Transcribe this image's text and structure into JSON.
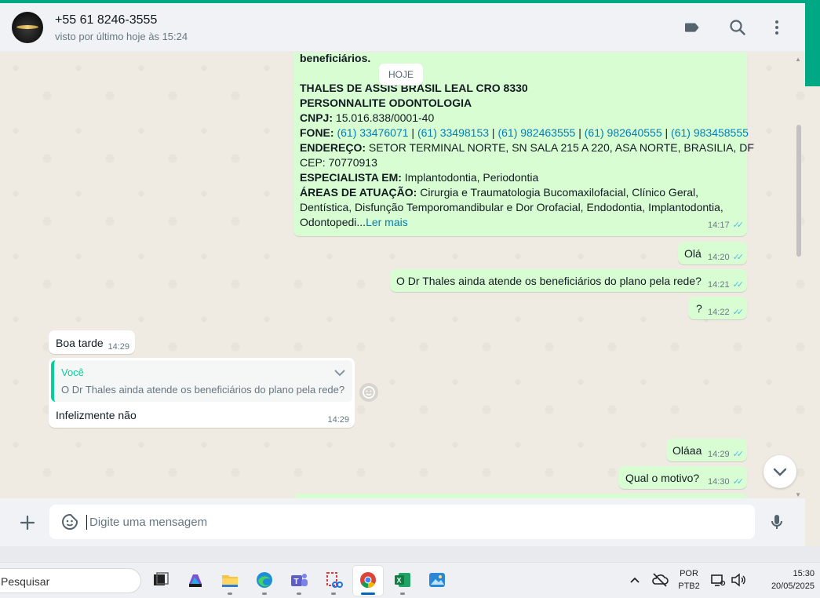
{
  "header": {
    "contact_name": "+55 61 8246-3555",
    "status": "visto por último hoje às 15:24",
    "icons": [
      "label-icon",
      "search-icon",
      "more-vertical-icon"
    ]
  },
  "date_chip": "HOJE",
  "big_message": {
    "line0_bold": "beneficiários.",
    "line1_bold": "THALES DE ASSIS BRASIL LEAL CRO 8330",
    "line2_bold": "PERSONNALITE ODONTOLOGIA",
    "cnpj_label": "CNPJ:",
    "cnpj_value": " 15.016.838/0001-40",
    "fone_label": "FONE:",
    "phones": [
      "(61) 33476071",
      "(61) 33498153",
      "(61) 982463555",
      "(61) 982640555",
      "(61) 983458555"
    ],
    "phone_sep": " | ",
    "endereco_label": "ENDEREÇO:",
    "endereco_value": " SETOR TERMINAL NORTE, SN SALA 215 A 220, ASA NORTE, BRASILIA, DF",
    "cep": "CEP: 70770913",
    "especialista_label": "ESPECIALISTA EM:",
    "especialista_value": " Implantodontia, Periodontia",
    "areas_label": "ÁREAS DE ATUAÇÃO:",
    "areas_value_1": " Cirurgia e Traumatologia Bucomaxilofacial, Clínico Geral,",
    "areas_value_2": "Dentística, Disfunção Temporomandibular e Dor Orofacial, Endodontia, Implantodontia,",
    "areas_value_3": "Odontopedi...",
    "read_more": "Ler mais",
    "time": "14:17"
  },
  "messages": [
    {
      "text": "Olá",
      "time": "14:20"
    },
    {
      "text": "O Dr Thales ainda atende os beneficiários do plano pela rede?",
      "time": "14:21"
    },
    {
      "text": "?",
      "time": "14:22"
    },
    {
      "text": "Boa tarde",
      "time": "14:29"
    },
    {
      "quote_author": "Você",
      "quote_text": "O Dr Thales ainda atende os beneficiários do plano pela rede?",
      "text": "Infelizmente não",
      "time": "14:29"
    },
    {
      "text": "Oláaa",
      "time": "14:29"
    },
    {
      "text": "Qual o motivo?",
      "time": "14:30"
    }
  ],
  "composer": {
    "placeholder": "Digite uma mensagem"
  },
  "taskbar": {
    "search_label": "Pesquisar",
    "lang_top": "POR",
    "lang_bottom": "PTB2",
    "clock_time": "15:30",
    "clock_date": "20/05/2025"
  },
  "colors": {
    "accent": "#00a884",
    "outgoing": "#d9fdd3",
    "incoming": "#ffffff",
    "link": "#027eb5",
    "read_ticks": "#53bdeb"
  }
}
